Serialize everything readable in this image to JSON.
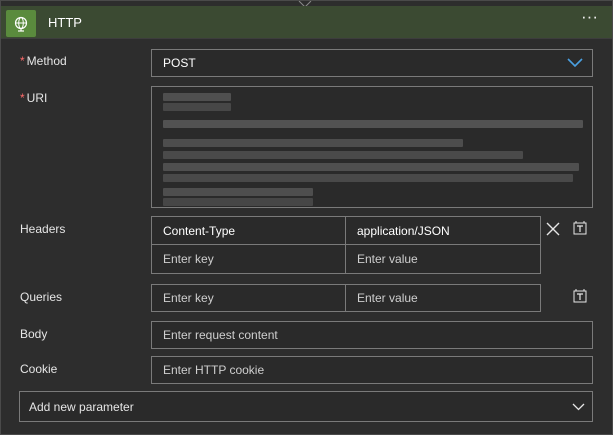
{
  "header": {
    "title": "HTTP",
    "more_label": "···",
    "app_icon": "globe-icon",
    "accent": "#5a8b3d"
  },
  "fields": {
    "method": {
      "label": "Method",
      "required_mark": "*",
      "value": "POST"
    },
    "uri": {
      "label": "URI",
      "required_mark": "*"
    },
    "headers": {
      "label": "Headers",
      "rows": [
        {
          "key": "Content-Type",
          "value": "application/JSON"
        },
        {
          "key": "Enter key",
          "value": "Enter value"
        }
      ]
    },
    "queries": {
      "label": "Queries",
      "key_placeholder": "Enter key",
      "value_placeholder": "Enter value"
    },
    "body": {
      "label": "Body",
      "placeholder": "Enter request content"
    },
    "cookie": {
      "label": "Cookie",
      "placeholder": "Enter HTTP cookie"
    }
  },
  "add_param": {
    "label": "Add new parameter"
  },
  "icons": {
    "method_dropdown": "chevron-down-icon",
    "header_remove": "close-icon",
    "header_switch": "text-mode-icon",
    "queries_switch": "text-mode-icon",
    "add_param_dropdown": "chevron-down-icon"
  },
  "colors": {
    "required": "#ff6b6b",
    "dropdown_chevron": "#4a9fe0"
  }
}
